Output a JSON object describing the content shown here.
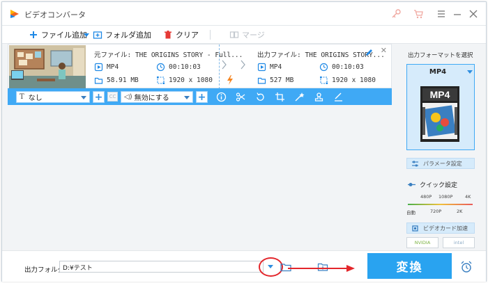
{
  "window": {
    "title": "ビデオコンバータ"
  },
  "toolbar": {
    "add_file": "ファイル追加",
    "add_folder": "フォルダ追加",
    "clear": "クリア",
    "merge": "マージ"
  },
  "file": {
    "source_name": "元ファイル: THE ORIGINS STORY - Full...",
    "output_name": "出力ファイル: THE ORIGINS STORY...",
    "source": {
      "format": "MP4",
      "duration": "00:10:03",
      "size": "58.91 MB",
      "resolution": "1920 x 1080"
    },
    "output": {
      "format": "MP4",
      "duration": "00:10:03",
      "size": "527 MB",
      "resolution": "1920 x 1080"
    }
  },
  "editbar": {
    "subtitle_select": "なし",
    "audio_select": "無効にする",
    "cc_label": "CC",
    "tools": [
      "info-icon",
      "scissors-icon",
      "rotate-icon",
      "crop-icon",
      "effects-icon",
      "watermark-icon",
      "subtitle-edit-icon"
    ]
  },
  "output_folder": {
    "label": "出力フォルダ:",
    "path": "D:¥テスト"
  },
  "convert_button": "変換",
  "right_panel": {
    "title": "出力フォーマットを選択",
    "format": "MP4",
    "format_icon_text": "MP4",
    "param_button": "パラメータ設定",
    "quick_title": "クイック設定",
    "slider_top": [
      "480P",
      "1080P",
      "4K"
    ],
    "slider_bottom": [
      "自動",
      "720P",
      "2K"
    ],
    "gpu_title": "ビデオカード加速",
    "gpu_nvidia": "NVIDIA",
    "gpu_intel": "intel"
  },
  "colors": {
    "accent": "#3fa9f5",
    "convert_bg": "#29a3f0",
    "annotation_red": "#e3262b",
    "lightning": "#f5841f"
  }
}
